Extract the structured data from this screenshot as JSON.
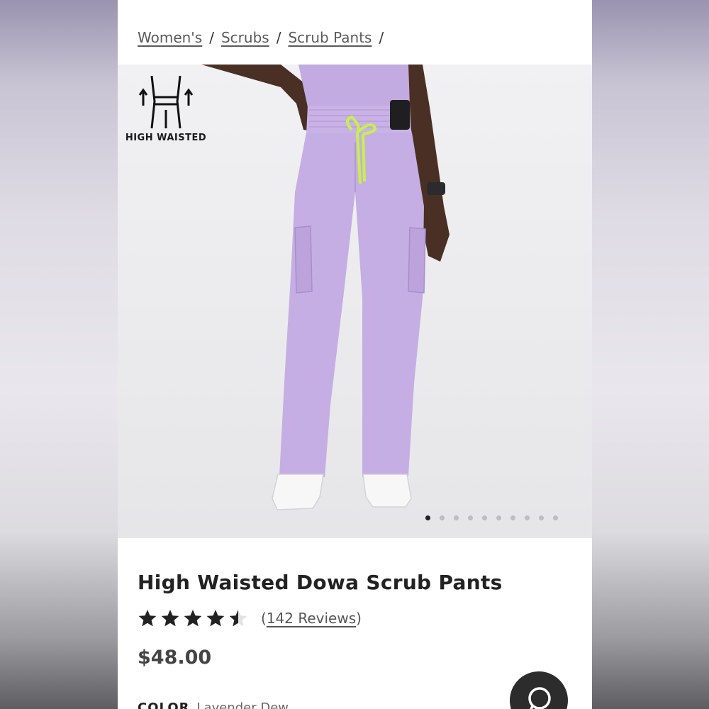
{
  "breadcrumb": {
    "items": [
      "Women's",
      "Scrubs",
      "Scrub Pants"
    ],
    "separator": "/"
  },
  "hero": {
    "badge_icon": "high-waist-icon",
    "badge_label": "HIGH WAISTED",
    "product_color": "#c5aee3",
    "drawstring_color": "#c8f04a",
    "carousel": {
      "total": 10,
      "active_index": 1
    }
  },
  "product": {
    "title": "High Waisted Dowa Scrub Pants",
    "rating": 4.5,
    "rating_max": 5,
    "reviews_open": "(",
    "reviews_text": "142 Reviews",
    "reviews_close": ")",
    "price": "$48.00",
    "color_label": "COLOR",
    "color_value": "Lavender Dew"
  },
  "chat": {
    "icon": "chat-bubble-icon"
  }
}
